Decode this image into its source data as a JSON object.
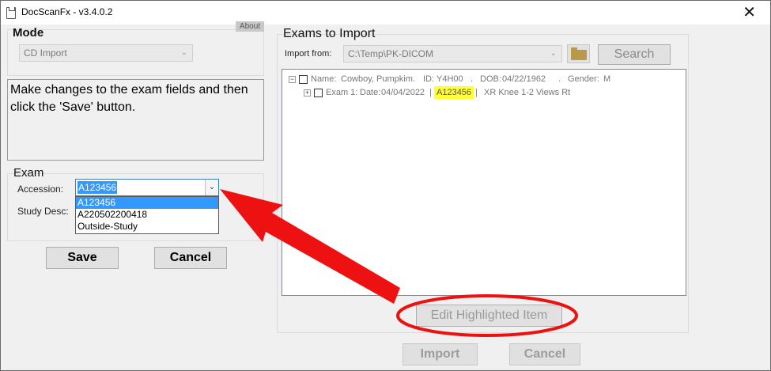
{
  "window": {
    "title": "DocScanFx  -  v3.4.0.2",
    "close_glyph": "✕"
  },
  "left": {
    "mode_title": "Mode",
    "about_label": "About",
    "mode_select_value": "CD Import",
    "instructions": "Make changes to the exam fields and then click the 'Save' button.",
    "exam_title": "Exam",
    "accession_label": "Accession:",
    "accession_value": "A123456",
    "accession_options": [
      "A123456",
      "A220502200418",
      "Outside-Study"
    ],
    "study_desc_label": "Study Desc:",
    "save_label": "Save",
    "cancel_label": "Cancel"
  },
  "right": {
    "title": "Exams to Import",
    "import_from_label": "Import from:",
    "import_from_value": "C:\\Temp\\PK-DICOM",
    "search_label": "Search",
    "tree": {
      "patient": {
        "name_label": "Name:",
        "name_value": "Cowboy, Pumpkim",
        "id_label": "ID:",
        "id_value": "Y4H00",
        "dob_label": "DOB:",
        "dob_value": "04/22/1962",
        "gender_label": "Gender:",
        "gender_value": "M"
      },
      "exam": {
        "label": "Exam 1:",
        "date_label": "Date:",
        "date_value": "04/04/2022",
        "accession": "A123456",
        "description": "XR Knee 1-2 Views Rt"
      }
    },
    "edit_label": "Edit Highlighted Item",
    "import_label": "Import",
    "cancel_label": "Cancel"
  },
  "colors": {
    "highlight": "#ffff33",
    "selection": "#3399ff",
    "annotation": "#ee1111"
  },
  "icons": [
    "folder-icon",
    "expand-icon",
    "chevron-down-icon",
    "close-icon"
  ]
}
